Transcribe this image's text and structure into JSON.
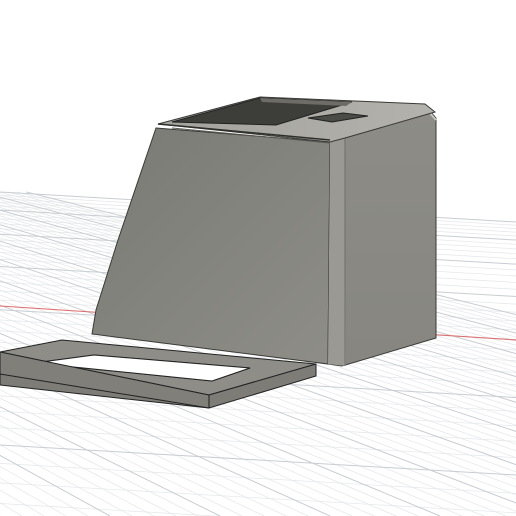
{
  "viewport": {
    "background": "#ffffff",
    "grid_major_color": "#c9cdd1",
    "grid_minor_color": "#e3e6e9",
    "x_axis_color": "#e06a6a"
  },
  "scene": {
    "objects": [
      {
        "name": "enclosure-body",
        "material_color": "#8b8a84"
      },
      {
        "name": "enclosure-lid-frame",
        "material_color": "#8e8d87"
      }
    ]
  }
}
